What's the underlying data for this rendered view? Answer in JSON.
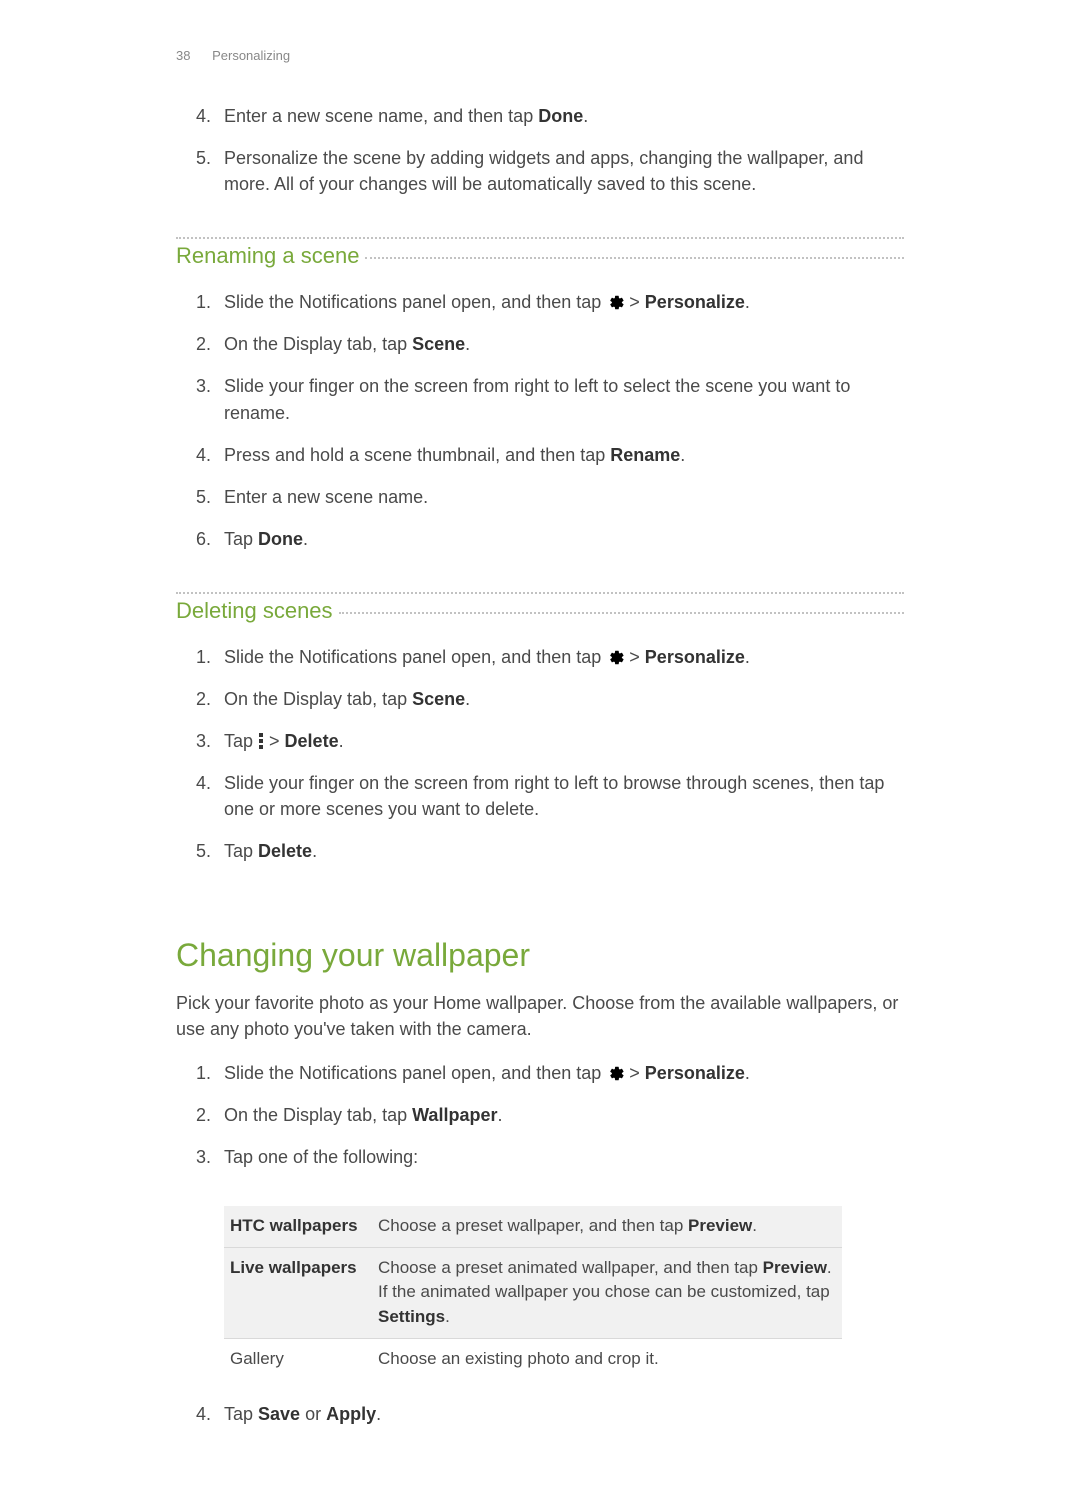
{
  "header": {
    "page_number": "38",
    "section": "Personalizing"
  },
  "continued_steps": [
    {
      "pre": "Enter a new scene name, and then tap ",
      "bold": "Done",
      "post": "."
    },
    {
      "pre": "Personalize the scene by adding widgets and apps, changing the wallpaper, and more. All of your changes will be automatically saved to this scene.",
      "bold": "",
      "post": ""
    }
  ],
  "renaming": {
    "title": "Renaming a scene",
    "steps": {
      "1": {
        "pre": "Slide the Notifications panel open, and then tap ",
        "after_icon": " > ",
        "bold": "Personalize",
        "post": "."
      },
      "2": {
        "pre": "On the Display tab, tap ",
        "bold": "Scene",
        "post": "."
      },
      "3": {
        "pre": "Slide your finger on the screen from right to left to select the scene you want to rename."
      },
      "4": {
        "pre": "Press and hold a scene thumbnail, and then tap ",
        "bold": "Rename",
        "post": "."
      },
      "5": {
        "pre": "Enter a new scene name."
      },
      "6": {
        "pre": "Tap ",
        "bold": "Done",
        "post": "."
      }
    }
  },
  "deleting": {
    "title": "Deleting scenes",
    "steps": {
      "1": {
        "pre": "Slide the Notifications panel open, and then tap ",
        "after_icon": " > ",
        "bold": "Personalize",
        "post": "."
      },
      "2": {
        "pre": "On the Display tab, tap ",
        "bold": "Scene",
        "post": "."
      },
      "3": {
        "pre": "Tap ",
        "after_icon": " > ",
        "bold": "Delete",
        "post": "."
      },
      "4": {
        "pre": "Slide your finger on the screen from right to left to browse through scenes, then tap one or more scenes you want to delete."
      },
      "5": {
        "pre": "Tap ",
        "bold": "Delete",
        "post": "."
      }
    }
  },
  "wallpaper": {
    "title": "Changing your wallpaper",
    "intro": "Pick your favorite photo as your Home wallpaper. Choose from the available wallpapers, or use any photo you've taken with the camera.",
    "steps": {
      "1": {
        "pre": "Slide the Notifications panel open, and then tap ",
        "after_icon": " > ",
        "bold": "Personalize",
        "post": "."
      },
      "2": {
        "pre": "On the Display tab, tap ",
        "bold": "Wallpaper",
        "post": "."
      },
      "3": {
        "pre": "Tap one of the following:"
      }
    },
    "table": [
      {
        "name": "HTC wallpapers",
        "desc_pre": "Choose a preset wallpaper, and then tap ",
        "bold": "Preview",
        "desc_post": "."
      },
      {
        "name": "Live wallpapers",
        "desc_pre": "Choose a preset animated wallpaper, and then tap ",
        "bold": "Preview",
        "desc_mid": ". If the animated wallpaper you chose can be customized, tap ",
        "bold2": "Settings",
        "desc_post": "."
      },
      {
        "name": "Gallery",
        "desc_pre": "Choose an existing photo and crop it."
      }
    ],
    "step4": {
      "pre": "Tap ",
      "bold": "Save",
      "mid": " or ",
      "bold2": "Apply",
      "post": "."
    }
  }
}
